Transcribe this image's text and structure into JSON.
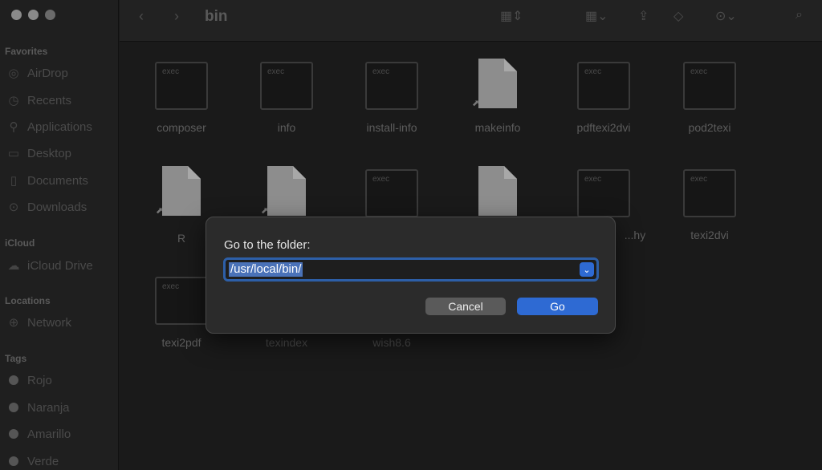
{
  "window": {
    "title": "bin"
  },
  "sidebar": {
    "favorites_header": "Favorites",
    "favorites": [
      {
        "label": "AirDrop",
        "icon": "airdrop-icon"
      },
      {
        "label": "Recents",
        "icon": "clock-icon"
      },
      {
        "label": "Applications",
        "icon": "applications-icon"
      },
      {
        "label": "Desktop",
        "icon": "desktop-icon"
      },
      {
        "label": "Documents",
        "icon": "document-icon"
      },
      {
        "label": "Downloads",
        "icon": "download-icon"
      }
    ],
    "icloud_header": "iCloud",
    "icloud": [
      {
        "label": "iCloud Drive",
        "icon": "cloud-icon"
      }
    ],
    "locations_header": "Locations",
    "locations": [
      {
        "label": "Network",
        "icon": "globe-icon"
      }
    ],
    "tags_header": "Tags",
    "tags": [
      {
        "label": "Rojo"
      },
      {
        "label": "Naranja"
      },
      {
        "label": "Amarillo"
      },
      {
        "label": "Verde"
      }
    ]
  },
  "files": [
    {
      "name": "composer",
      "kind": "exec",
      "badge": "exec"
    },
    {
      "name": "info",
      "kind": "exec",
      "badge": "exec"
    },
    {
      "name": "install-info",
      "kind": "exec",
      "badge": "exec"
    },
    {
      "name": "makeinfo",
      "kind": "alias"
    },
    {
      "name": "pdftexi2dvi",
      "kind": "exec",
      "badge": "exec"
    },
    {
      "name": "pod2texi",
      "kind": "exec",
      "badge": "exec"
    },
    {
      "name": "R",
      "kind": "alias"
    },
    {
      "name": "",
      "kind": "alias"
    },
    {
      "name": "",
      "kind": "exec",
      "badge": "exec"
    },
    {
      "name": "",
      "kind": "doc"
    },
    {
      "name": "...hy",
      "kind": "exec",
      "badge": "exec"
    },
    {
      "name": "texi2dvi",
      "kind": "exec",
      "badge": "exec"
    },
    {
      "name": "texi2pdf",
      "kind": "exec",
      "badge": "exec"
    },
    {
      "name": "texindex",
      "kind": "none"
    },
    {
      "name": "wish8.6",
      "kind": "none"
    }
  ],
  "dialog": {
    "title": "Go to the folder:",
    "path_value": "/usr/local/bin/",
    "cancel_label": "Cancel",
    "go_label": "Go"
  }
}
